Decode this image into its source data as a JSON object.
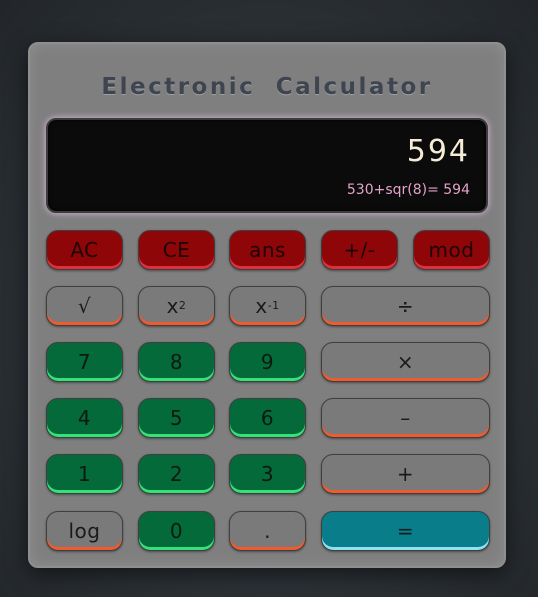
{
  "title": "Electronic Calculator",
  "display": {
    "result": "594",
    "history": "530+sqr(8)= 594"
  },
  "buttons": {
    "ac": "AC",
    "ce": "CE",
    "ans": "ans",
    "negate": "+/-",
    "mod": "mod",
    "sqrt": "√",
    "square_base": "x",
    "square_exp": "2",
    "inverse_base": "x",
    "inverse_exp": "-1",
    "divide": "÷",
    "seven": "7",
    "eight": "8",
    "nine": "9",
    "multiply": "×",
    "four": "4",
    "five": "5",
    "six": "6",
    "subtract": "–",
    "one": "1",
    "two": "2",
    "three": "3",
    "add": "+",
    "log": "log",
    "zero": "0",
    "decimal": ".",
    "equals": "="
  },
  "colors": {
    "function_keys": "#8e0608",
    "operator_keys": "#7a7a7a",
    "digit_keys": "#046a3a",
    "equals_key": "#0a7d8a",
    "display_text": "#f4ecd6",
    "history_text": "#e3a2c8"
  }
}
